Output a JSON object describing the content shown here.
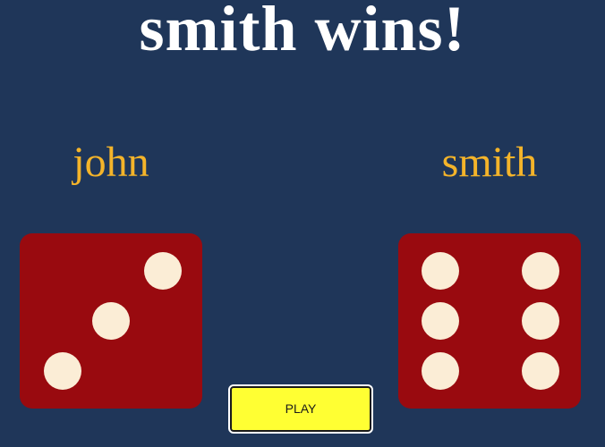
{
  "game": {
    "result_text": "smith wins!",
    "play_label": "PLAY"
  },
  "players": [
    {
      "name": "john",
      "die_value": 3
    },
    {
      "name": "smith",
      "die_value": 6
    }
  ],
  "colors": {
    "background": "#1f3659",
    "title": "#ffffff",
    "player_name": "#f4b42a",
    "die_face": "#990a0f",
    "die_pip": "#fbedd6",
    "play_button": "#ffff33"
  }
}
